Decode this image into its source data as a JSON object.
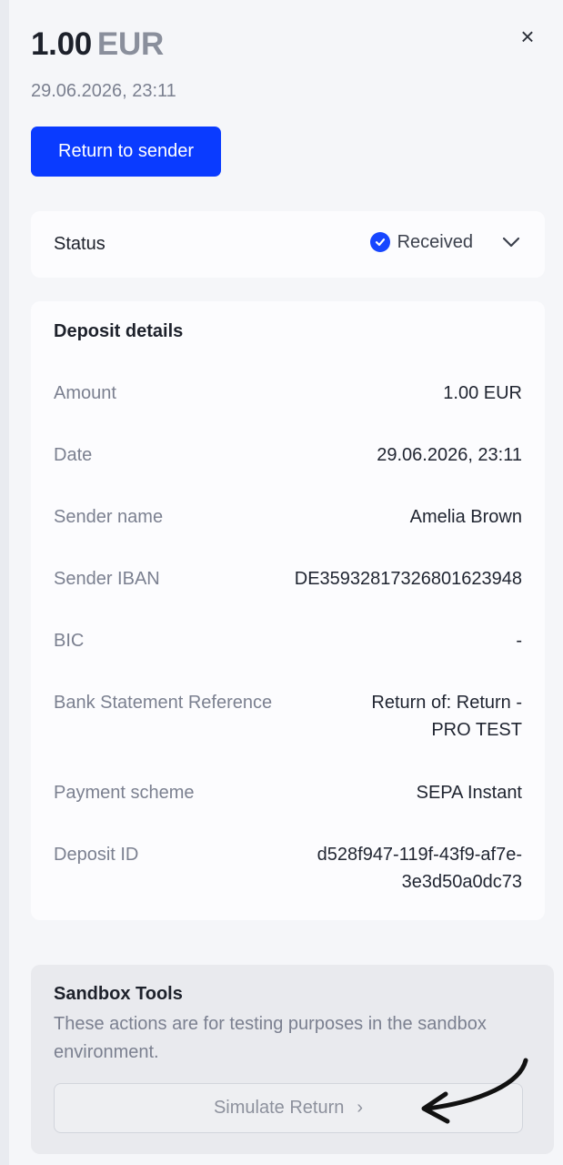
{
  "header": {
    "amount": "1.00",
    "currency": "EUR",
    "datetime": "29.06.2026, 23:11",
    "close_symbol": "×"
  },
  "actions": {
    "return_label": "Return to sender"
  },
  "status": {
    "label": "Status",
    "value": "Received",
    "icon": "check-circle-icon",
    "accent_color": "#1746ff"
  },
  "deposit": {
    "title": "Deposit details",
    "rows": [
      {
        "label": "Amount",
        "value": "1.00 EUR"
      },
      {
        "label": "Date",
        "value": "29.06.2026, 23:11"
      },
      {
        "label": "Sender name",
        "value": "Amelia Brown"
      },
      {
        "label": "Sender IBAN",
        "value": "DE35932817326801623948"
      },
      {
        "label": "BIC",
        "value": "-"
      },
      {
        "label": "Bank Statement Reference",
        "value": "Return of: Return - PRO TEST"
      },
      {
        "label": "Payment scheme",
        "value": "SEPA Instant"
      },
      {
        "label": "Deposit ID",
        "value": "d528f947-119f-43f9-af7e-3e3d50a0dc73"
      }
    ]
  },
  "sandbox": {
    "title": "Sandbox Tools",
    "description": "These actions are for testing purposes in the sandbox environment.",
    "simulate_label": "Simulate Return",
    "simulate_chevron": "›"
  },
  "colors": {
    "primary_button": "#0a3bff",
    "panel_background": "#f5f6f9"
  }
}
